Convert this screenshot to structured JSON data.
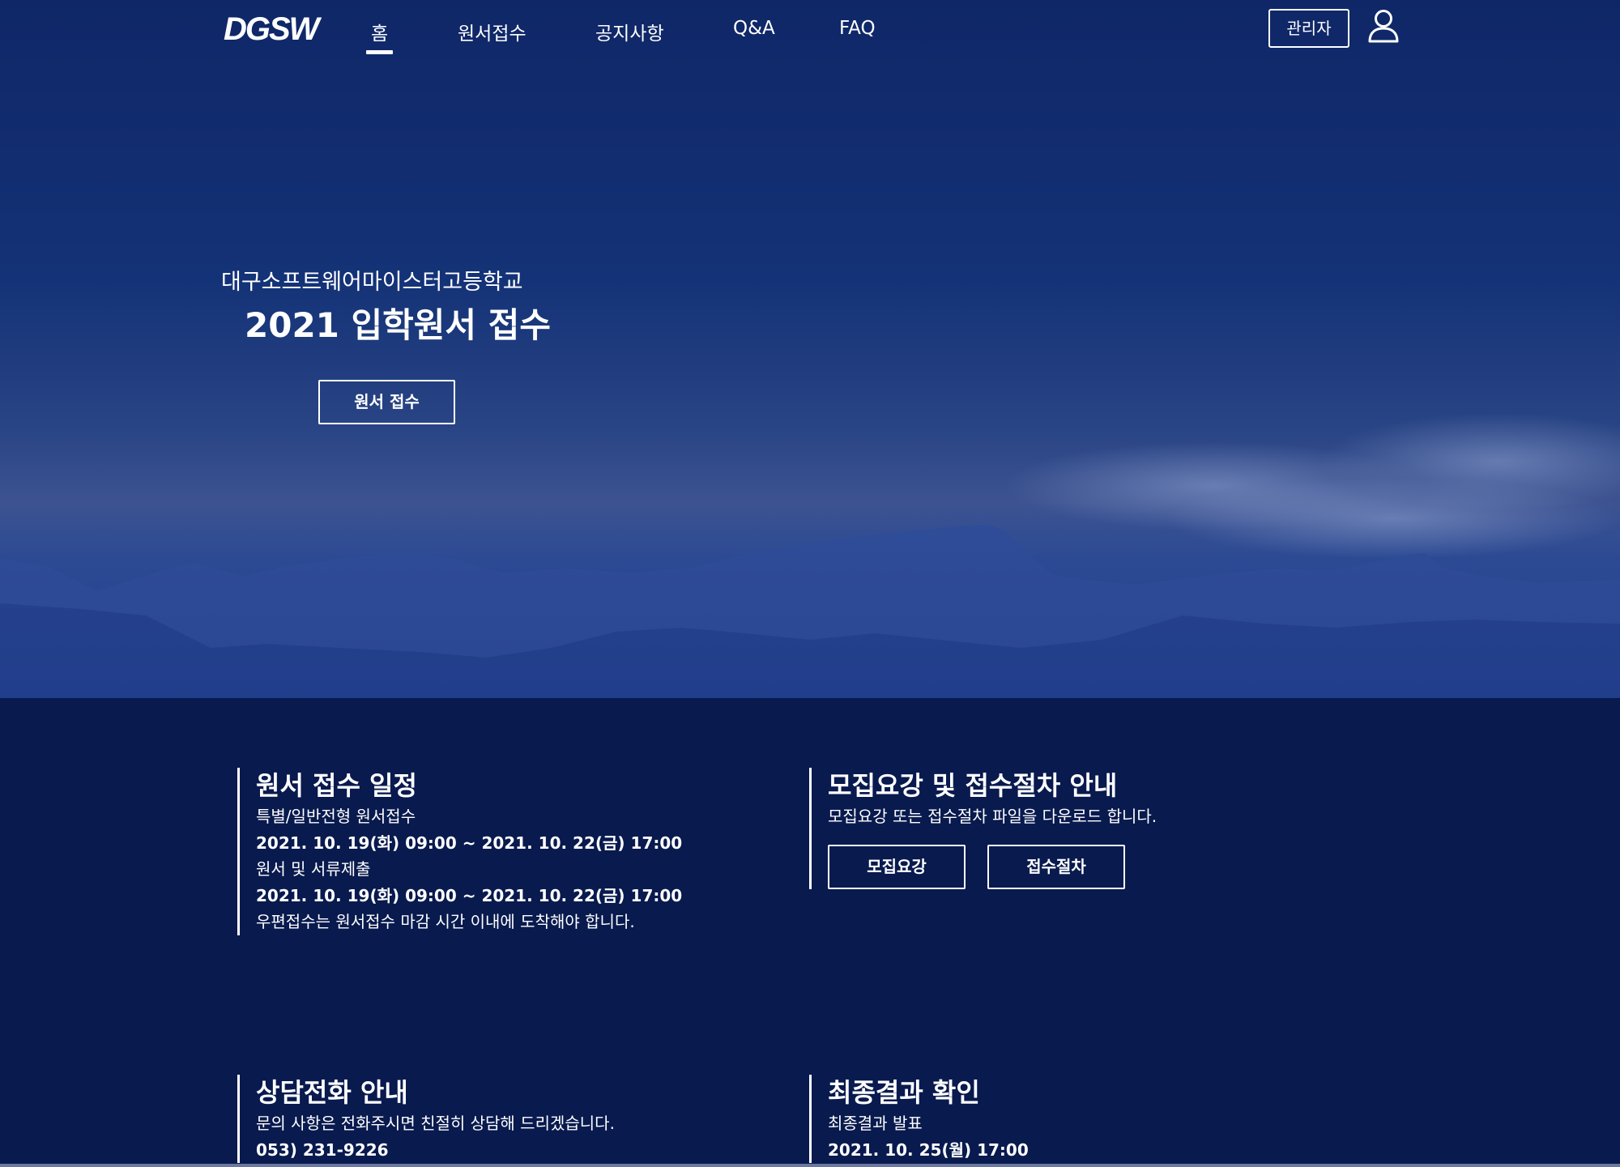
{
  "nav": {
    "logo": "DGSW",
    "items": [
      {
        "label": "홈",
        "active": true
      },
      {
        "label": "원서접수",
        "active": false
      },
      {
        "label": "공지사항",
        "active": false
      },
      {
        "label": "Q&A",
        "active": false
      },
      {
        "label": "FAQ",
        "active": false
      }
    ],
    "admin_label": "관리자",
    "user_icon": "user-icon"
  },
  "hero": {
    "subtitle": "대구소프트웨어마이스터고등학교",
    "title": "2021 입학원서 접수",
    "button_label": "원서 접수"
  },
  "sections": {
    "schedule": {
      "title": "원서 접수 일정",
      "lines": [
        {
          "text": "특별/일반전형 원서접수",
          "bold": false
        },
        {
          "text": "2021. 10. 19(화) 09:00 ~ 2021. 10. 22(금) 17:00",
          "bold": true
        },
        {
          "text": "원서 및 서류제출",
          "bold": false
        },
        {
          "text": "2021. 10. 19(화) 09:00 ~ 2021. 10. 22(금) 17:00",
          "bold": true
        },
        {
          "text": "우편접수는 원서접수 마감 시간 이내에 도착해야 합니다.",
          "bold": false
        }
      ]
    },
    "guide": {
      "title": "모집요강 및 접수절차 안내",
      "description": "모집요강 또는 접수절차 파일을 다운로드 합니다.",
      "buttons": [
        "모집요강",
        "접수절차"
      ]
    },
    "contact": {
      "title": "상담전화 안내",
      "description": "문의 사항은 전화주시면 친절히 상담해 드리겠습니다.",
      "phone": "053) 231-9226"
    },
    "result": {
      "title": "최종결과 확인",
      "description": "최종결과 발표",
      "date": "2021. 10. 25(월) 17:00"
    }
  },
  "colors": {
    "page_background": "#081a4e",
    "hero_top": "#0f2767",
    "hero_horizon": "#3d5391",
    "text": "#ffffff"
  }
}
